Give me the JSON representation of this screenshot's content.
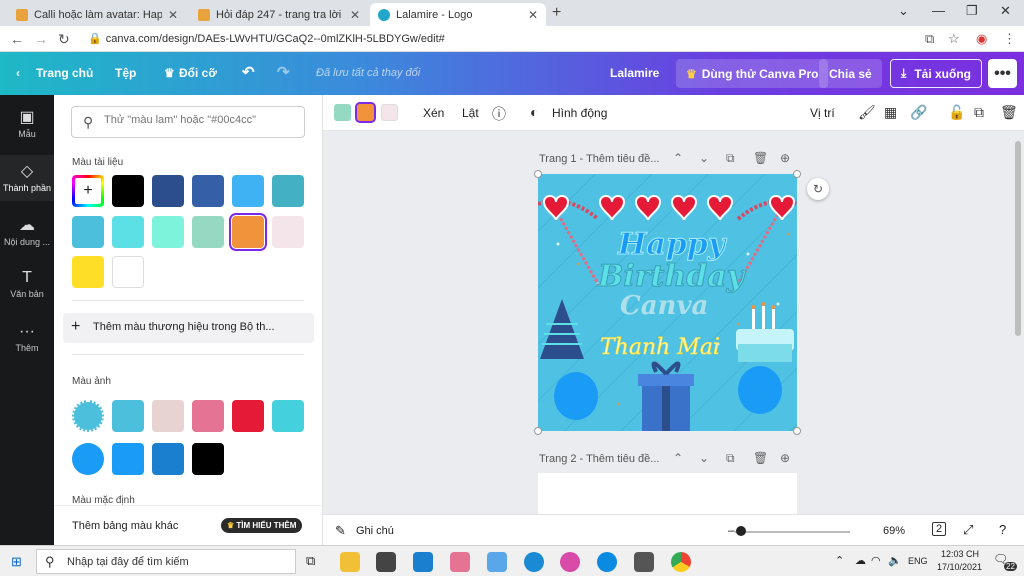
{
  "browser": {
    "tabs": [
      {
        "title": "Calli hoặc làm avatar: Happy Birth",
        "active": false
      },
      {
        "title": "Hỏi đáp 247 - trang tra lời",
        "active": false
      },
      {
        "title": "Lalamire - Logo",
        "active": true
      }
    ],
    "url": "canva.com/design/DAEs-LWvHTU/GCaQ2--0mlZKlH-5LBDYGw/edit#"
  },
  "topbar": {
    "home": "Trang chủ",
    "file": "Tệp",
    "resize": "Đổi cỡ",
    "saved_status": "Đã lưu tất cả thay đổi",
    "design_name": "Lalamire",
    "try_pro": "Dùng thử Canva Pro",
    "share": "Chia sẻ",
    "download": "Tải xuống"
  },
  "rail": {
    "items": [
      {
        "label": "Mẫu",
        "icon": "template-icon"
      },
      {
        "label": "Thành phần",
        "icon": "elements-icon"
      },
      {
        "label": "Nội dung ...",
        "icon": "upload-icon"
      },
      {
        "label": "Văn bản",
        "icon": "text-icon"
      },
      {
        "label": "Thêm",
        "icon": "more-icon"
      }
    ]
  },
  "panel": {
    "search_placeholder": "Thử \"màu lam\" hoặc \"#00c4cc\"",
    "doc_colors_title": "Màu tài liệu",
    "doc_colors": [
      "#000000",
      "#2d4e8c",
      "#3560a8",
      "#3eb2f2",
      "#43b0c4",
      "#4bbfdb",
      "#5ce0e6",
      "#7cf3da",
      "#96d9c3",
      "#f0933b",
      "#f3e5ea",
      "#ffde27",
      "#ffffff"
    ],
    "selected_color": "#f0933b",
    "brand_add": "Thêm màu thương hiệu trong Bộ th...",
    "photo_colors_title": "Màu ảnh",
    "photo_colors": [
      "#4bbfdb",
      "#e8d3d3",
      "#e57393",
      "#e41a37",
      "#45d0de",
      "#1a9bf5",
      "#1a7fcf",
      "#000000"
    ],
    "default_colors_title": "Màu mặc định",
    "palette_label": "Thêm bảng màu khác",
    "learn_more": "TÌM HIỂU THÊM"
  },
  "editor_toolbar": {
    "swatches": [
      "#96d9c3",
      "#f0933b",
      "#f3e5ea"
    ],
    "crop": "Xén",
    "flip": "Lật",
    "animate": "Hình động",
    "position": "Vị trí"
  },
  "canvas": {
    "page1_title": "Trang 1 - Thêm tiêu đề...",
    "page2_title": "Trang 2 - Thêm tiêu đề...",
    "design_text": {
      "line1": "Happy",
      "line2": "Birthday",
      "line3": "Canva",
      "name": "Thanh Mai"
    }
  },
  "bottombar": {
    "notes": "Ghi chú",
    "zoom": "69%",
    "page_count": "2"
  },
  "taskbar": {
    "search_placeholder": "Nhập tại đây để tìm kiếm",
    "lang": "ENG",
    "time": "12:03 CH",
    "date": "17/10/2021",
    "notifications": "22"
  }
}
